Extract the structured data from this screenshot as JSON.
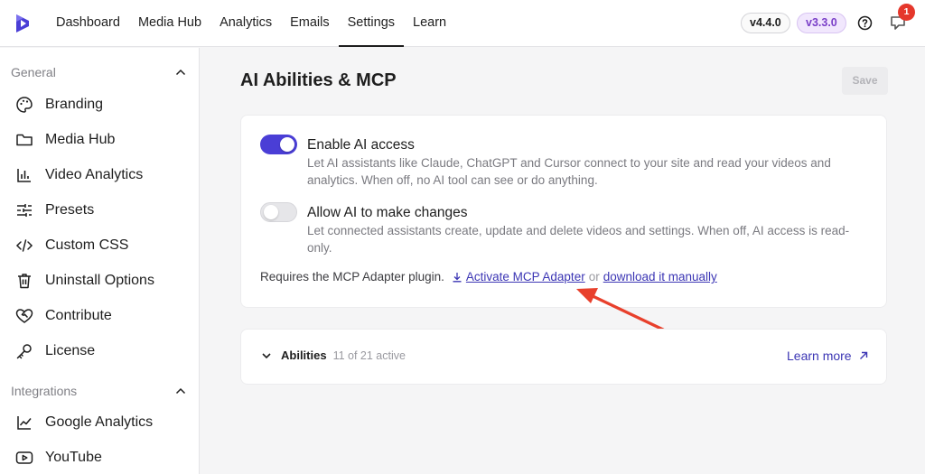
{
  "topbar": {
    "nav": [
      "Dashboard",
      "Media Hub",
      "Analytics",
      "Emails",
      "Settings",
      "Learn"
    ],
    "active_index": 4,
    "version_plugin": "v4.4.0",
    "version_pro": "v3.3.0",
    "notification_count": "1",
    "colors": {
      "accent": "#4a3ed6",
      "badge": "#e5372b"
    }
  },
  "sidebar": {
    "general_label": "General",
    "general_items": [
      {
        "label": "Branding",
        "icon": "palette-icon"
      },
      {
        "label": "Media Hub",
        "icon": "folder-icon"
      },
      {
        "label": "Video Analytics",
        "icon": "bar-chart-icon"
      },
      {
        "label": "Presets",
        "icon": "sliders-icon"
      },
      {
        "label": "Custom CSS",
        "icon": "code-icon"
      },
      {
        "label": "Uninstall Options",
        "icon": "trash-icon"
      },
      {
        "label": "Contribute",
        "icon": "heart-handshake-icon"
      },
      {
        "label": "License",
        "icon": "key-icon"
      }
    ],
    "integrations_label": "Integrations",
    "integration_items": [
      {
        "label": "Google Analytics",
        "icon": "line-chart-icon"
      },
      {
        "label": "YouTube",
        "icon": "youtube-icon"
      }
    ]
  },
  "main": {
    "title": "AI Abilities & MCP",
    "save_label": "Save",
    "options": [
      {
        "title": "Enable AI access",
        "enabled": true,
        "description": "Let AI assistants like Claude, ChatGPT and Cursor connect to your site and read your videos and analytics. When off, no AI tool can see or do anything."
      },
      {
        "title": "Allow AI to make changes",
        "enabled": false,
        "description": "Let connected assistants create, update and delete videos and settings. When off, AI access is read-only."
      }
    ],
    "requires_text": "Requires the MCP Adapter plugin.",
    "activate_link": "Activate MCP Adapter",
    "or_text": "or",
    "download_link": "download it manually",
    "abilities_label": "Abilities",
    "abilities_count": "11 of 21 active",
    "learn_more": "Learn more"
  }
}
